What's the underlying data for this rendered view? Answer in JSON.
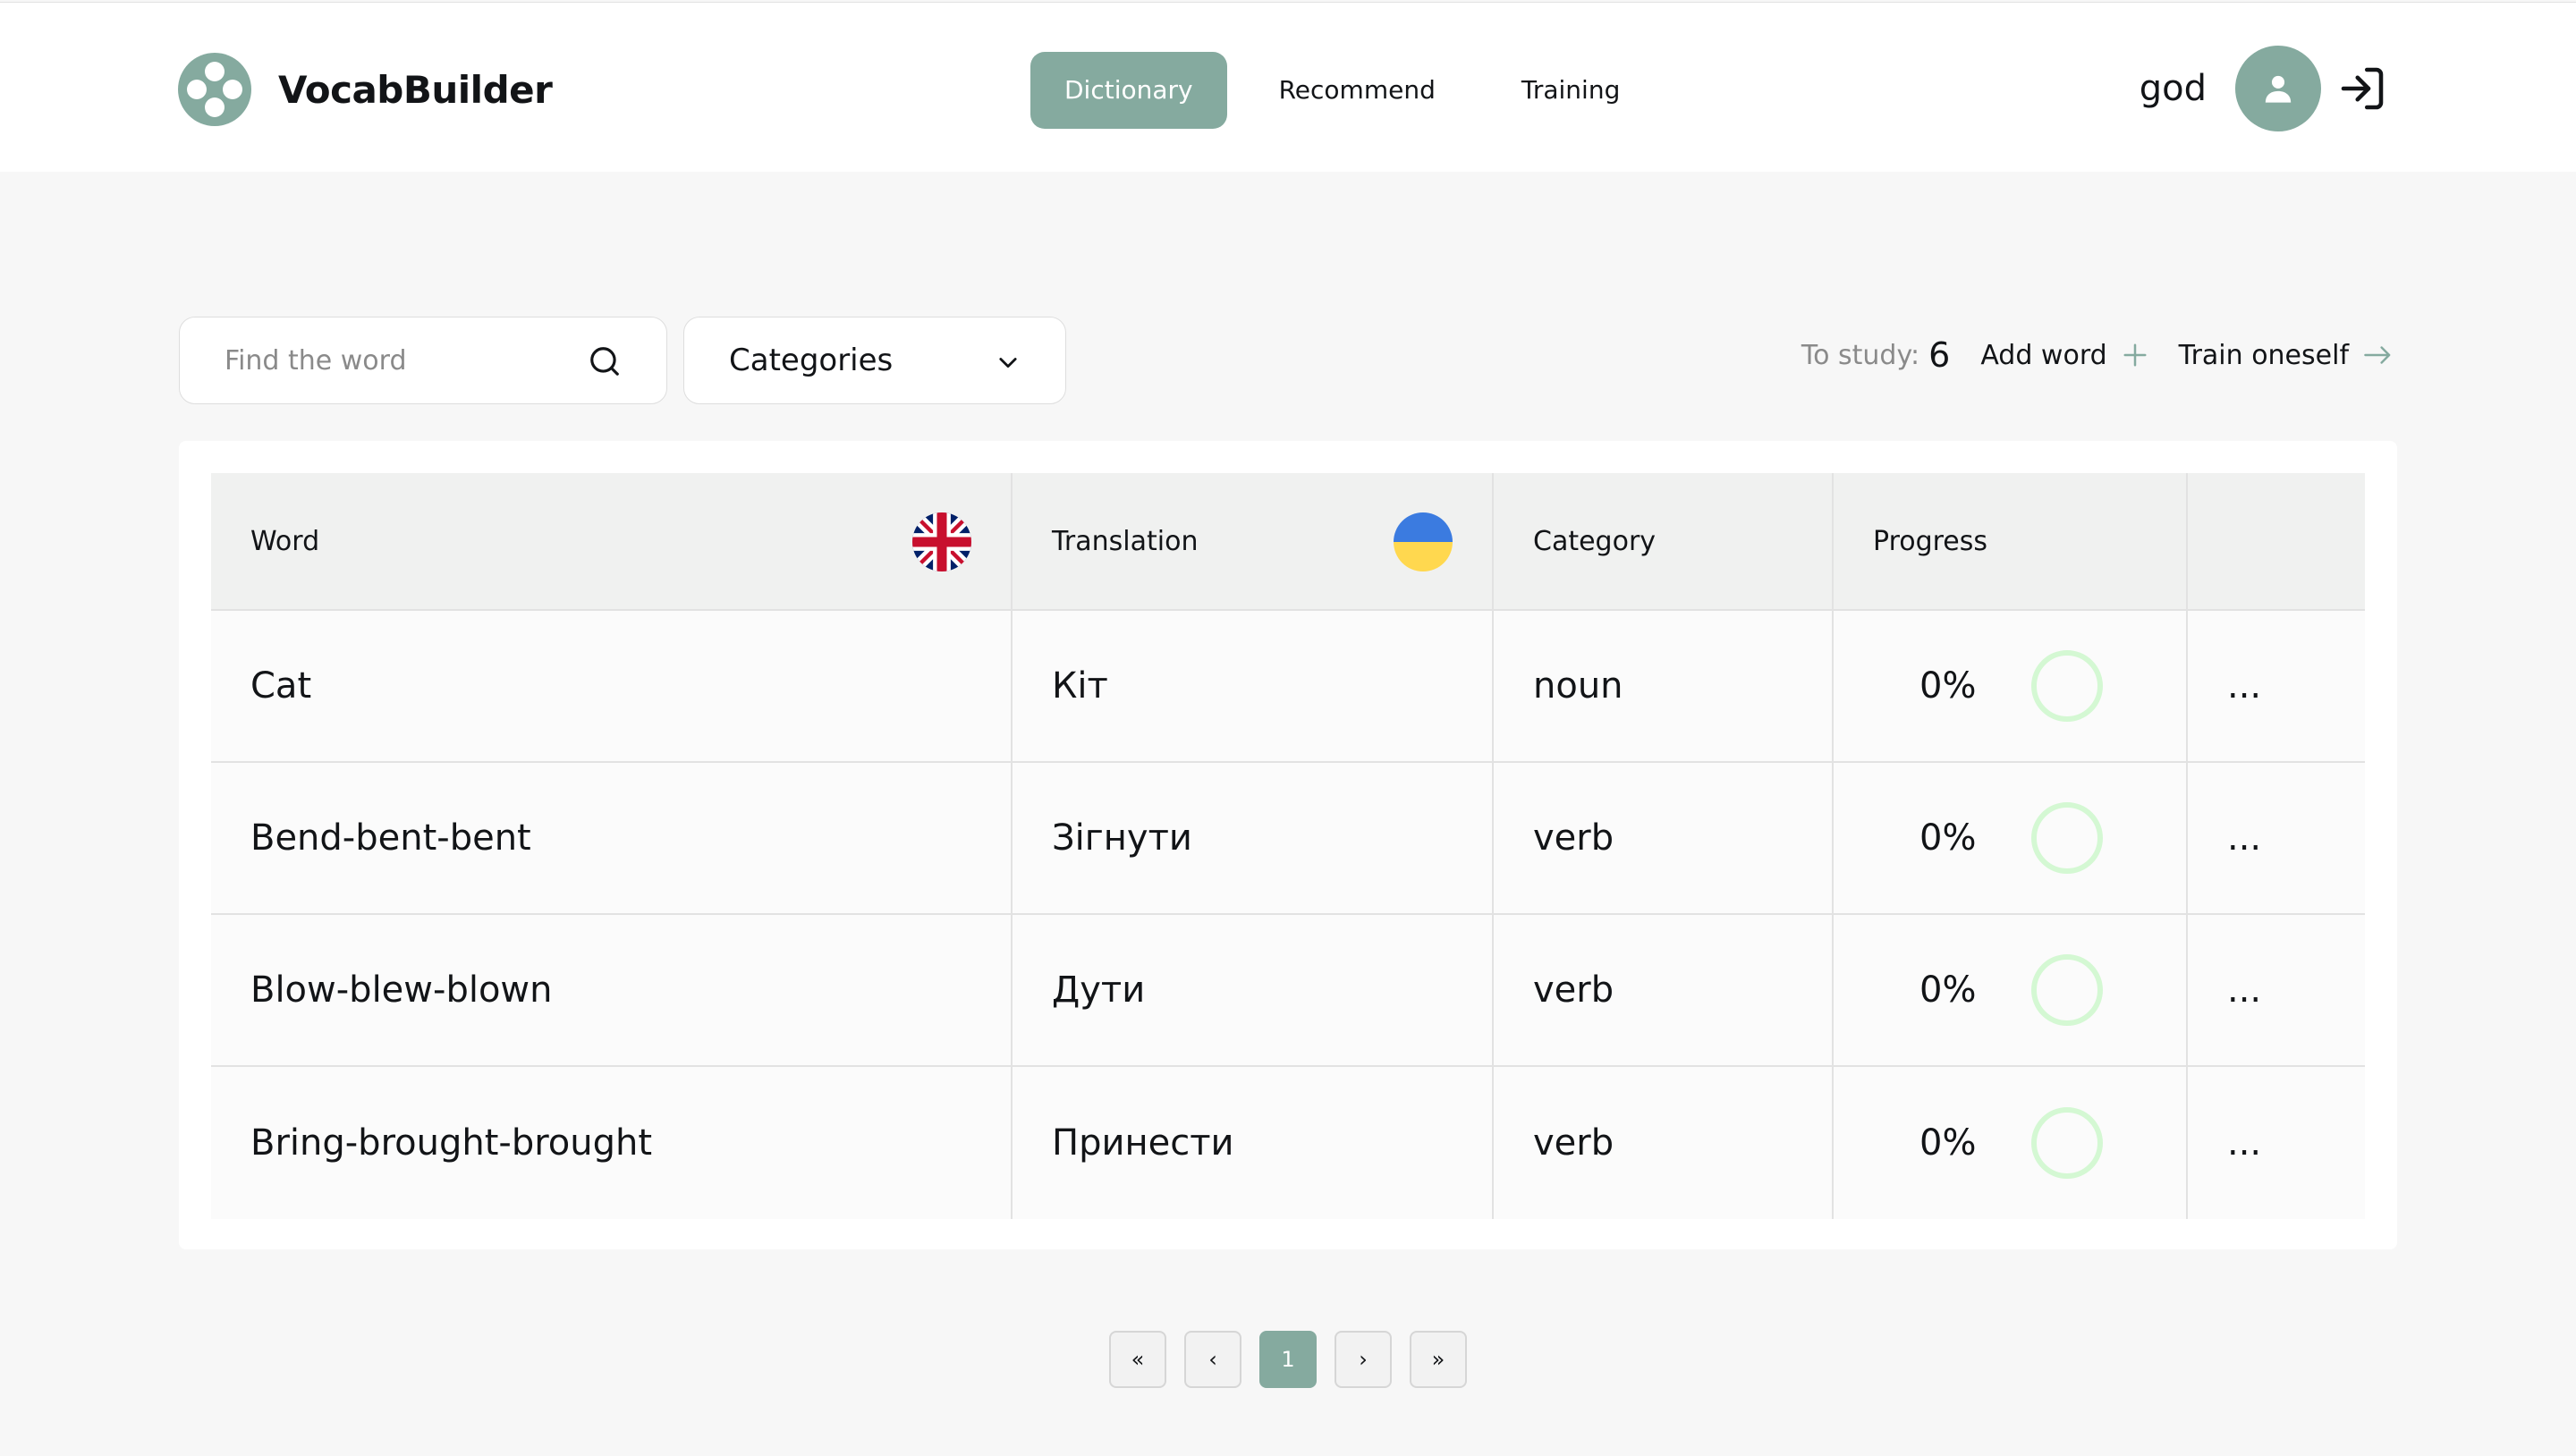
{
  "app": {
    "name": "VocabBuilder"
  },
  "nav": [
    {
      "label": "Dictionary",
      "active": true
    },
    {
      "label": "Recommend",
      "active": false
    },
    {
      "label": "Training",
      "active": false
    }
  ],
  "user": {
    "name": "god"
  },
  "toolbar": {
    "search_placeholder": "Find the word",
    "categories_label": "Categories",
    "to_study_label": "To study:",
    "to_study_count": "6",
    "add_word_label": "Add word",
    "train_label": "Train oneself"
  },
  "table": {
    "headers": {
      "word": "Word",
      "translation": "Translation",
      "category": "Category",
      "progress": "Progress"
    },
    "rows": [
      {
        "word": "Cat",
        "translation": "Кіт",
        "category": "noun",
        "progress": "0%",
        "more": "..."
      },
      {
        "word": "Bend-bent-bent",
        "translation": "Зігнути",
        "category": "verb",
        "progress": "0%",
        "more": "..."
      },
      {
        "word": "Blow-blew-blown",
        "translation": "Дути",
        "category": "verb",
        "progress": "0%",
        "more": "..."
      },
      {
        "word": "Bring-brought-brought",
        "translation": "Принести",
        "category": "verb",
        "progress": "0%",
        "more": "..."
      }
    ]
  },
  "pagination": {
    "first": "«",
    "prev": "‹",
    "current": "1",
    "next": "›",
    "last": "»"
  },
  "colors": {
    "accent": "#85aa9f",
    "ring": "#d4f8d3",
    "background": "#f7f7f7"
  }
}
